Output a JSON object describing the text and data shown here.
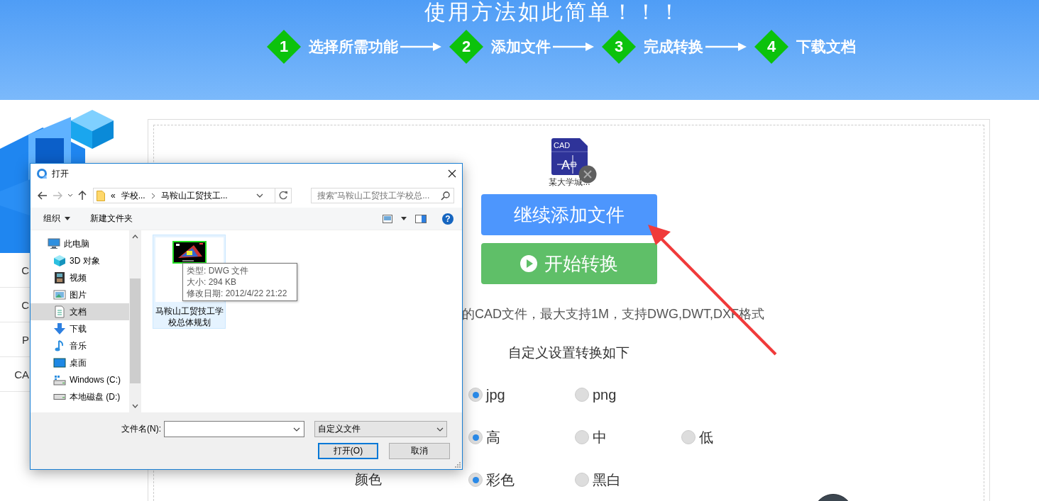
{
  "banner": {
    "title": "使用方法如此简单！！！",
    "steps": [
      {
        "number": "1",
        "label": "选择所需功能"
      },
      {
        "number": "2",
        "label": "添加文件"
      },
      {
        "number": "3",
        "label": "完成转换"
      },
      {
        "number": "4",
        "label": "下载文档"
      }
    ]
  },
  "sidebar": {
    "items": [
      "C",
      "C",
      "P",
      "CA"
    ]
  },
  "upload": {
    "file": {
      "icon_label": "CAD",
      "glyph": "A",
      "name": "某大学城..."
    },
    "add_button": "继续添加文件",
    "convert_button": "开始转换",
    "description": "的CAD文件，最大支持1M，支持DWG,DWT,DXF格式",
    "settings_title": "自定义设置转换如下",
    "option_groups": [
      {
        "options": [
          {
            "label": "jpg",
            "selected": true
          },
          {
            "label": "png",
            "selected": false
          }
        ]
      },
      {
        "options": [
          {
            "label": "高",
            "selected": true
          },
          {
            "label": "中",
            "selected": false
          },
          {
            "label": "低",
            "selected": false
          }
        ]
      },
      {
        "label": "颜色",
        "options": [
          {
            "label": "彩色",
            "selected": true
          },
          {
            "label": "黑白",
            "selected": false
          }
        ]
      }
    ]
  },
  "dialog": {
    "title": "打开",
    "address": {
      "overflow_mark": "«",
      "segments": [
        "学校...",
        "马鞍山工贸技工..."
      ]
    },
    "search": {
      "placeholder": "搜索\"马鞍山工贸技工学校总..."
    },
    "toolbar": {
      "organize": "组织",
      "new_folder": "新建文件夹",
      "help": "?"
    },
    "nav_items": [
      {
        "label": "此电脑",
        "kind": "pc",
        "selected": false,
        "children": [
          {
            "label": "3D 对象",
            "kind": "cube",
            "selected": false
          },
          {
            "label": "视频",
            "kind": "video",
            "selected": false
          },
          {
            "label": "图片",
            "kind": "picture",
            "selected": false
          },
          {
            "label": "文档",
            "kind": "document",
            "selected": true
          },
          {
            "label": "下载",
            "kind": "download",
            "selected": false
          },
          {
            "label": "音乐",
            "kind": "music",
            "selected": false
          },
          {
            "label": "桌面",
            "kind": "desktop",
            "selected": false
          },
          {
            "label": "Windows (C:)",
            "kind": "system-drive",
            "selected": false
          },
          {
            "label": "本地磁盘 (D:)",
            "kind": "drive",
            "selected": false
          }
        ]
      }
    ],
    "files": [
      {
        "name": "马鞍山工贸技工学校总体规划",
        "selected": true
      }
    ],
    "tooltip": {
      "lines": [
        "类型: DWG 文件",
        "大小: 294 KB",
        "修改日期: 2012/4/22 21:22"
      ]
    },
    "filename": {
      "label": "文件名(N):"
    },
    "filter": "自定义文件",
    "buttons": [
      {
        "label": "打开(O)",
        "default": true
      },
      {
        "label": "取消",
        "default": false
      }
    ]
  }
}
